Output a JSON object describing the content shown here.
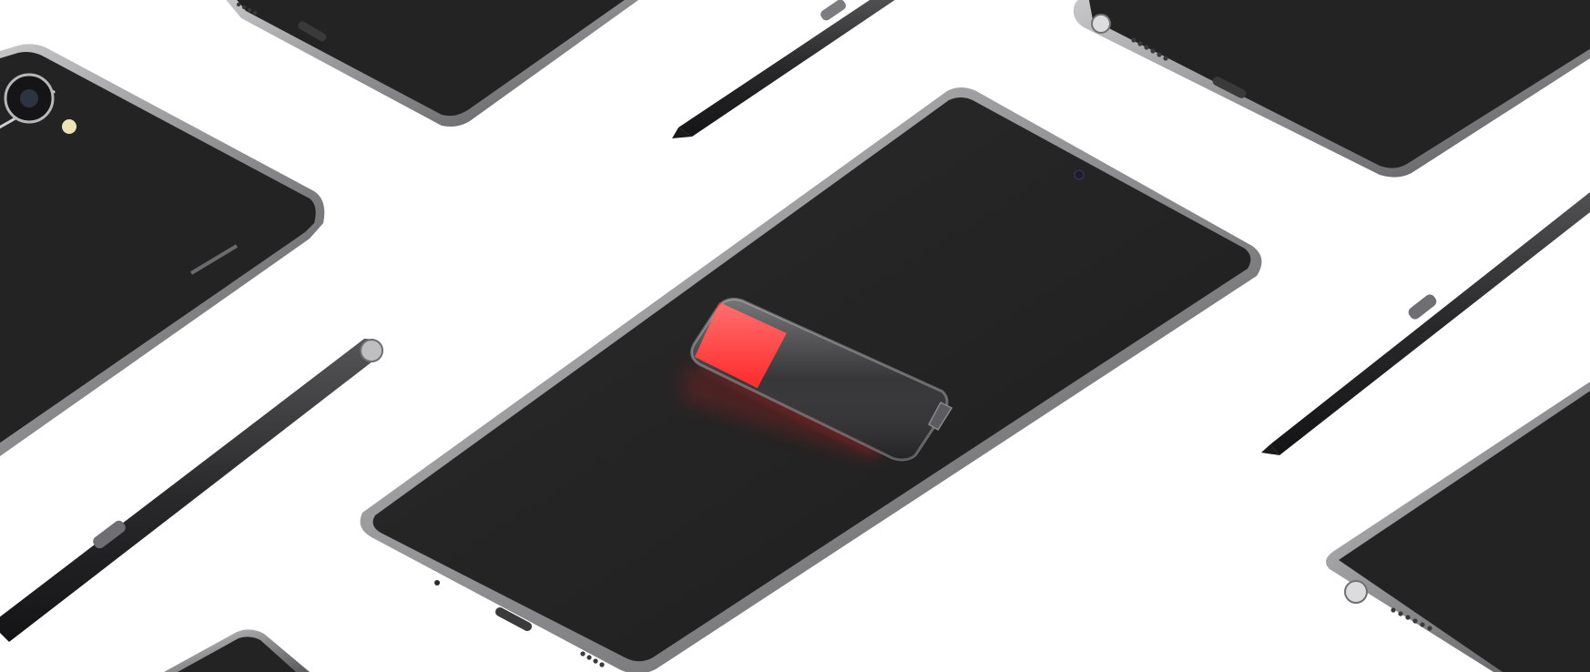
{
  "scene": {
    "description_visible_text": "",
    "background_color": "#ffffff",
    "device_body_color": "#232323",
    "device_frame_color": "#8f8f91",
    "stylus_color": "#2b2b2d",
    "battery": {
      "charge_level": 0.3,
      "charge_color": "#ff2626",
      "empty_color": "#2c2c2e"
    }
  }
}
